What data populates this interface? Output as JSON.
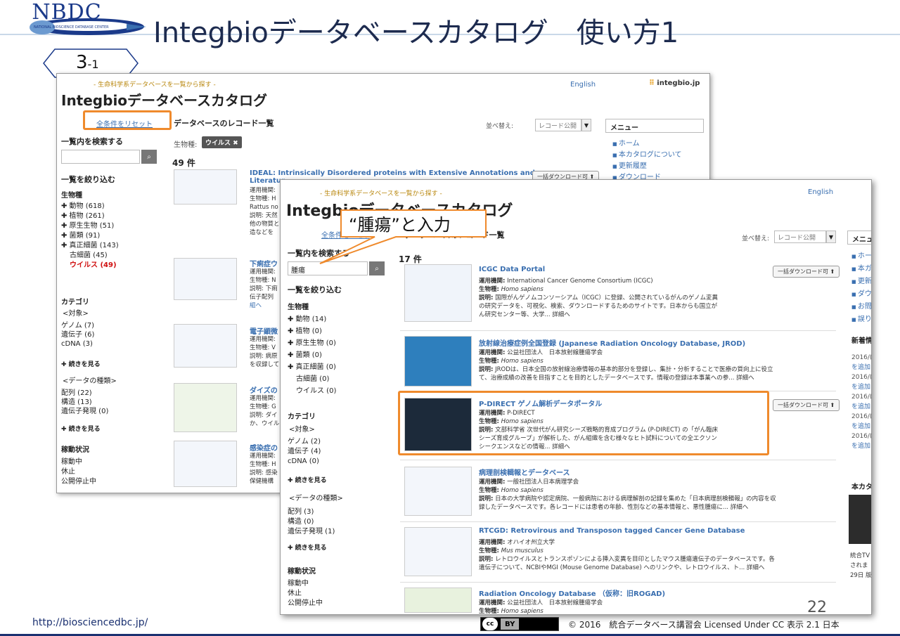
{
  "slide": {
    "logo_text": "NBDC",
    "logo_sub": "NATIONAL BIOSCIENCE DATABASE CENTER",
    "title": "Integbioデータベースカタログ　使い方1",
    "step_main": "3",
    "step_sub": "-1",
    "callout": "“腫瘍”と入力",
    "page_number": "22",
    "footer_url": "http://biosciencedbc.jp/",
    "cc_label": "cc",
    "cc_by": "BY",
    "copyright": "© 2016　統合データベース講習会 Licensed Under CC 表示 2.1 日本"
  },
  "back": {
    "tagline": "- 生命科学系データベースを一覧から探す -",
    "site_title": "Integbioデータベースカタログ",
    "english": "English",
    "brand": "integbio.jp",
    "reset": "全条件をリセット",
    "list_title": "データベースのレコード一覧",
    "search_heading": "一覧内を検索する",
    "sort_label": "並べ替え:",
    "sort_value": "レコード公開",
    "filter_label": "生物種:",
    "chip": "ウイルス ✖",
    "count": "49 件",
    "narrow_heading": "一覧を絞り込む",
    "species_heading": "生物種",
    "species": [
      "✚ 動物 (618)",
      "✚ 植物 (261)",
      "✚ 原生生物 (51)",
      "✚ 菌類 (91)",
      "✚ 真正細菌 (143)",
      "古細菌 (45)",
      "ウイルス (49)"
    ],
    "category_heading": "カテゴリ",
    "target_heading": "<対象>",
    "targets": [
      "ゲノム (7)",
      "遺伝子 (6)",
      "cDNA (3)"
    ],
    "more1": "✚ 続きを見る",
    "datatype_heading": "<データの種類>",
    "datatypes": [
      "配列 (22)",
      "構造 (13)",
      "遺伝子発現 (0)"
    ],
    "more2": "✚ 続きを見る",
    "status_heading": "稼動状況",
    "statuses": [
      "稼動中",
      "休止",
      "公開停止中"
    ],
    "menu_title": "メニュー",
    "menu": [
      "ホーム",
      "本カタログについて",
      "更新履歴",
      "ダウンロード"
    ],
    "records": [
      {
        "title": "IDEAL: Intrinsically Disordered proteins with Extensive Annotations and",
        "title2": "Literatur",
        "lines": [
          "運用機関:",
          "生物種: H",
          "Rattus no",
          "説明: 天然",
          "他の物質と",
          "造などを"
        ]
      },
      {
        "title": "下痢症ウ",
        "lines": [
          "運用機関:",
          "生物種: N",
          "説明: 下痢",
          "伝子配列",
          "組へ"
        ]
      },
      {
        "title": "電子顕微",
        "lines": [
          "運用機関:",
          "生物種: V",
          "説明: 病原",
          "を収録して"
        ]
      },
      {
        "title": "ダイズの",
        "lines": [
          "運用機関:",
          "生物種: G",
          "説明: ダイ",
          "か、ウイル"
        ]
      },
      {
        "title": "感染症の",
        "lines": [
          "運用機関:",
          "生物種: H",
          "説明: 感染",
          "保健機構"
        ]
      }
    ],
    "bulk_download": "一括ダウンロード可 ⬆"
  },
  "front": {
    "tagline": "- 生命科学系データベースを一覧から探す -",
    "site_title": "Integbioデータベースカタログ",
    "english": "English",
    "reset": "全条件をリセット",
    "list_title": "データベースのレコード一覧",
    "search_heading": "一覧内を検索する",
    "search_value": "腫瘍",
    "sort_label": "並べ替え:",
    "sort_value": "レコード公開",
    "count": "17 件",
    "narrow_heading": "一覧を絞り込む",
    "species_heading": "生物種",
    "species": [
      "✚ 動物 (14)",
      "✚ 植物 (0)",
      "✚ 原生生物 (0)",
      "✚ 菌類 (0)",
      "✚ 真正細菌 (0)",
      "古細菌 (0)",
      "ウイルス (0)"
    ],
    "category_heading": "カテゴリ",
    "target_heading": "<対象>",
    "targets": [
      "ゲノム (2)",
      "遺伝子 (4)",
      "cDNA (0)"
    ],
    "more1": "✚ 続きを見る",
    "datatype_heading": "<データの種類>",
    "datatypes": [
      "配列 (3)",
      "構造 (0)",
      "遺伝子発現 (1)"
    ],
    "more2": "✚ 続きを見る",
    "status_heading": "稼動状況",
    "statuses": [
      "稼動中",
      "休止",
      "公開停止中"
    ],
    "menu_title": "メニュー",
    "menu": [
      "ホー",
      "本ガ",
      "更新",
      "ダウ",
      "お問",
      "誤り"
    ],
    "news_heading": "新着情",
    "news": [
      "2016/(",
      "を追加",
      "2016/(",
      "を追加",
      "2016/(",
      "を追加",
      "2016/(",
      "を追加",
      "2016/(",
      "を追加"
    ],
    "honkata": "本カタ",
    "tv": [
      "統合TV",
      "されま",
      "29日 版"
    ],
    "bulk_download": "一括ダウンロード可 ⬆",
    "records": [
      {
        "title": "ICGC Data Portal",
        "org": "International Cancer Genome Consortium (ICGC)",
        "species": "Homo sapiens",
        "desc": "国際がんゲノムコンソーシアム（ICGC）に登録、公開されているがんのゲノム変異",
        "desc2": "の研究データを、可視化、検索、ダウンロードするためのサイトです。日本からも国立が",
        "desc3": "ん研究センター等、大学... 詳細へ"
      },
      {
        "title": "放射線治療症例全国登録 (Japanese Radiation Oncology Database, JROD)",
        "org": "公益社団法人　日本放射線腫瘍学会",
        "species": "Homo sapiens",
        "desc": "JRODは、日本全国の放射線治療情報の基本的部分を登録し、集計・分析することで医療の質向上に役立",
        "desc2": "て、治療成績の改善を目指すことを目的としたデータベースです。情報の登録は本事業への参... 詳細へ",
        "desc3": ""
      },
      {
        "title": "P-DIRECT ゲノム解析データポータル",
        "org": "P-DIRECT",
        "species": "Homo sapiens",
        "desc": "文部科学省 次世代がん研究シーズ戦略的育成プログラム (P-DIRECT) の「がん臨床",
        "desc2": "シーズ育成グループ」が解析した、がん組織を含む様々なヒト試料についての全エクソン",
        "desc3": "シークエンスなどの情報... 詳細へ"
      },
      {
        "title": "病理剖検輯報とデータベース",
        "org": "一般社団法人日本病理学会",
        "species": "Homo sapiens",
        "desc": "日本の大学病院や認定病院、一般病院における病理解剖の記録を集めた「日本病理剖検輯報」の内容を収",
        "desc2": "録したデータベースです。各レコードには患者の年齢、性別などの基本情報と、悪性腫瘍に... 詳細へ",
        "desc3": ""
      },
      {
        "title": "RTCGD: Retrovirous and Transposon tagged Cancer Gene Database",
        "org": "オハイオ州立大学",
        "species": "Mus musculus",
        "desc": "レトロウイルスとトランスポゾンによる挿入変異を目印としたマウス腫瘍遺伝子のデータベースです。各",
        "desc2": "遺伝子について、NCBIやMGI (Mouse Genome Database) へのリンクや、レトロウイルス、ト... 詳細へ",
        "desc3": ""
      },
      {
        "title": "Radiation Oncology Database （仮称：旧ROGAD)",
        "org": "公益社団法人　日本放射線腫瘍学会",
        "species": "Homo sapiens",
        "desc": "",
        "desc2": "",
        "desc3": ""
      }
    ],
    "label_org": "運用機関:",
    "label_species": "生物種:",
    "label_desc": "説明:"
  }
}
